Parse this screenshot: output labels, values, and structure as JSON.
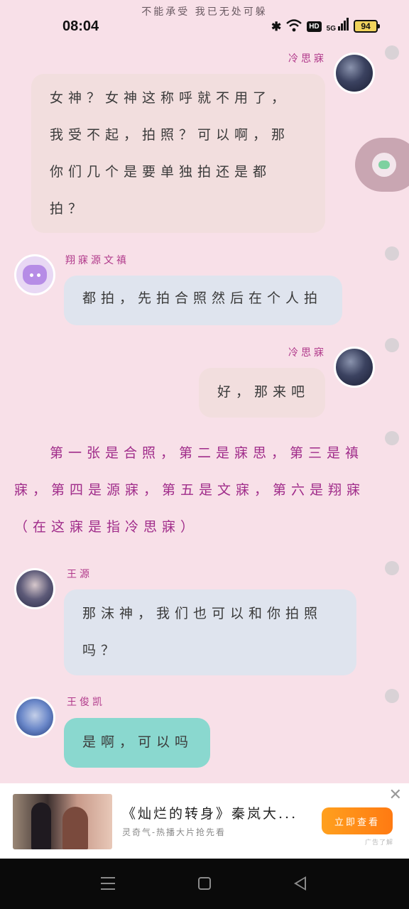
{
  "status_bar": {
    "book_title": "不能承受 我已无处可躲",
    "time": "08:04",
    "battery": "94",
    "hd_label": "HD",
    "network": "5G"
  },
  "chat": {
    "messages": [
      {
        "sender": "冷思寐",
        "side": "right",
        "text": "女神？女神这称呼就不用了，我受不起，拍照？可以啊，那你们几个是要单独拍还是都拍？"
      },
      {
        "sender": "翔寐源文禛",
        "side": "left",
        "text": "都拍，先拍合照然后在个人拍"
      },
      {
        "sender": "冷思寐",
        "side": "right",
        "text": "好，那来吧"
      },
      {
        "sender": "王源",
        "side": "left",
        "text": "那沫神，我们也可以和你拍照吗？"
      },
      {
        "sender": "王俊凯",
        "side": "left",
        "text": "是啊，可以吗"
      }
    ],
    "narration": "第一张是合照，第二是寐思，第三是禛寐，第四是源寐，第五是文寐，第六是翔寐（在这寐是指冷思寐）"
  },
  "ad": {
    "title": "《灿烂的转身》秦岚大...",
    "subtitle": "灵奇气-热播大片抢先看",
    "button_label": "立即查看",
    "close_icon": "close-icon",
    "tag": "广告了解"
  },
  "colors": {
    "background": "#f8e0e8",
    "name": "#b0388a",
    "narration": "#a02c8a",
    "bubble_peach": "#f2dede",
    "bubble_blue": "#dfe4ee",
    "bubble_teal": "#8ad8cf",
    "ad_button": "#ff8c18"
  }
}
